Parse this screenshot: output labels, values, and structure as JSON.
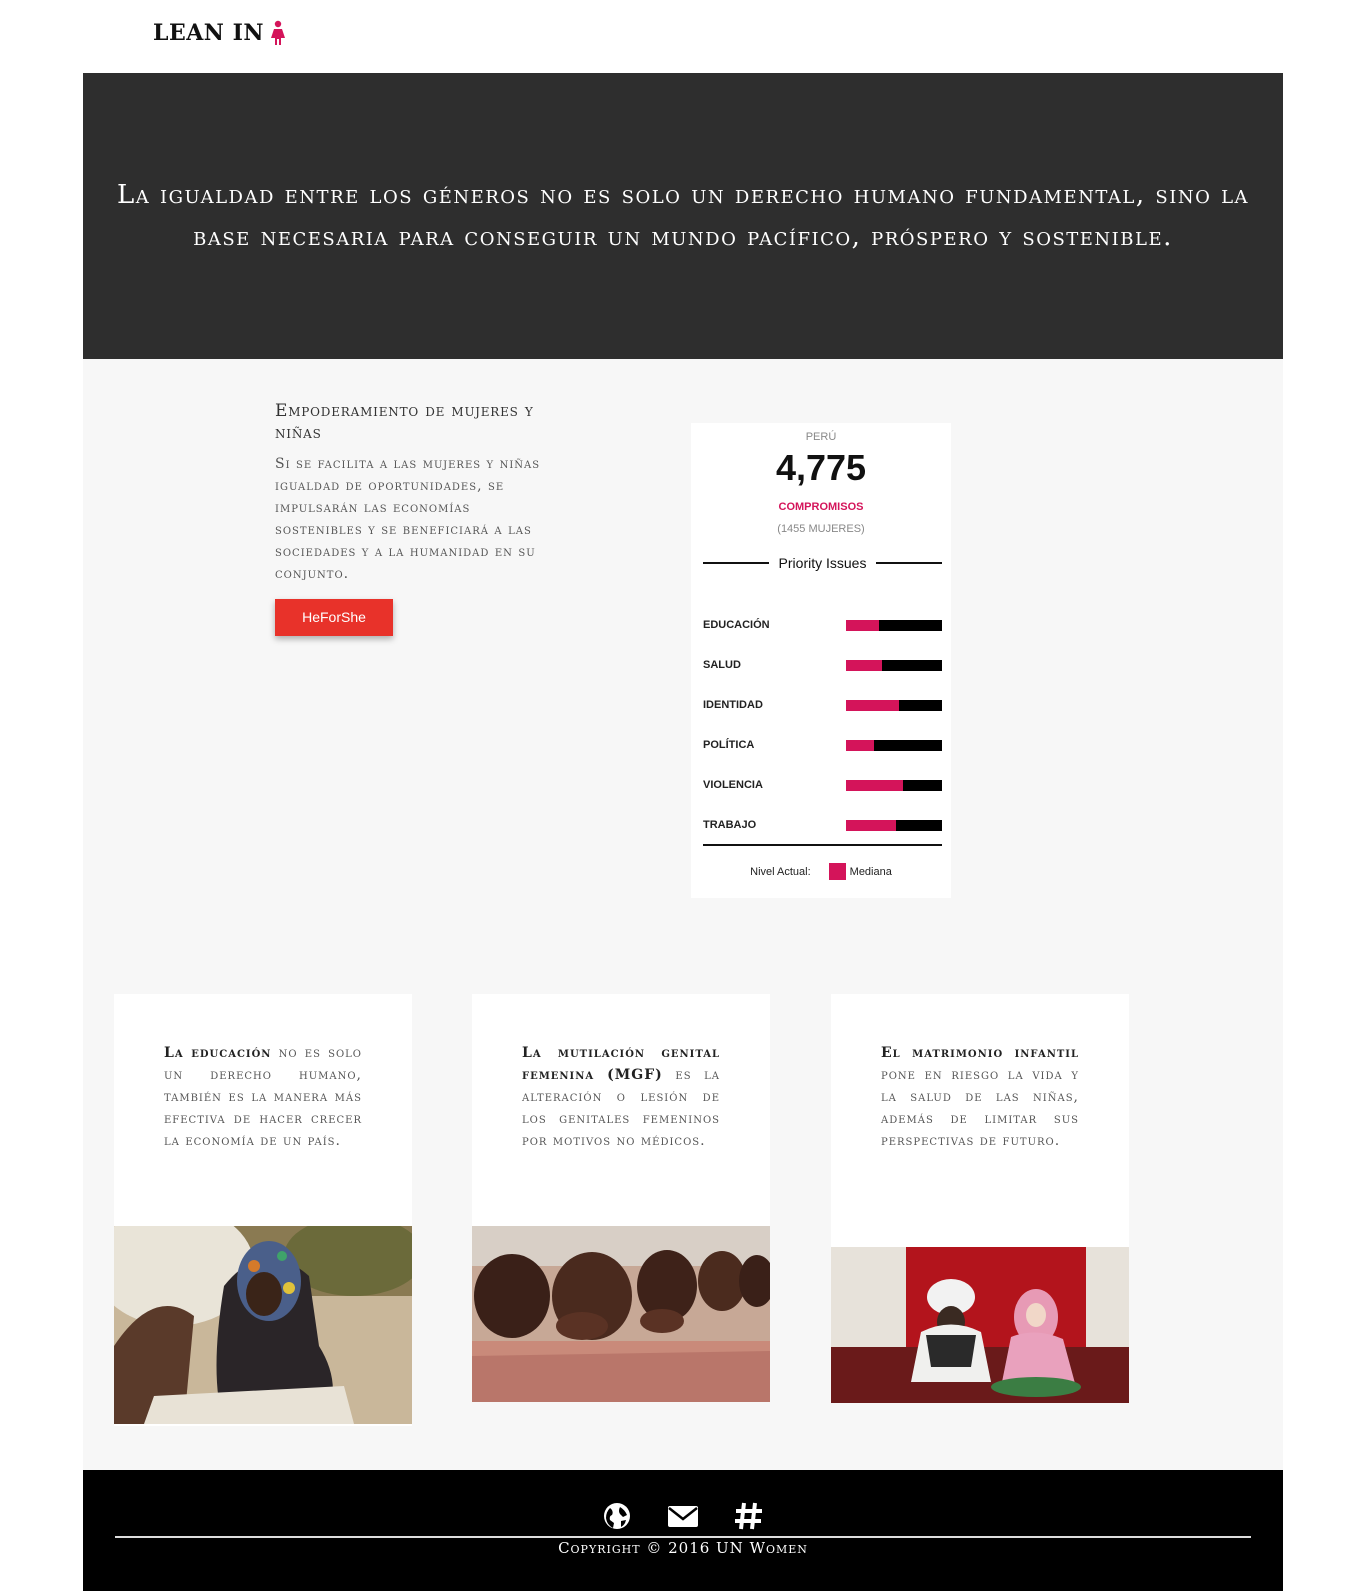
{
  "header": {
    "logo_text": "LEAN IN",
    "logo_icon": "woman-icon",
    "accent": "#d4145a"
  },
  "hero": {
    "quote": "La igualdad entre los géneros no es solo un derecho humano fundamental, sino la base necesaria para conseguir un mundo pacífico, próspero y sostenible."
  },
  "intro": {
    "title": "Empoderamiento de mujeres y niñas",
    "text": "Si se facilita a las mujeres y niñas igualdad de oportunidades, se impulsarán las economías sostenibles y se beneficiará a las sociedades y a la humanidad en su conjunto.",
    "button_label": "HeForShe",
    "button_color": "#e8322a"
  },
  "widget": {
    "country": "PERÚ",
    "count": "4,775",
    "label": "COMPROMISOS",
    "sub": "(1455 MUJERES)",
    "priority_title": "Priority Issues",
    "issues": [
      {
        "name": "EDUCACIÓN",
        "level": 0.34
      },
      {
        "name": "SALUD",
        "level": 0.38
      },
      {
        "name": "IDENTIDAD",
        "level": 0.55
      },
      {
        "name": "POLÍTICA",
        "level": 0.29
      },
      {
        "name": "VIOLENCIA",
        "level": 0.59
      },
      {
        "name": "TRABAJO",
        "level": 0.52
      }
    ],
    "legend_label": "Nivel Actual:",
    "legend_value": "Mediana",
    "bar_color": "#d4145a"
  },
  "cards": [
    {
      "bold": "La educación",
      "text": " no es solo un derecho humano, también es la manera más efectiva de hacer crecer la economía de un país.",
      "image": "student-writing-photo"
    },
    {
      "bold": "La mutilación genital femenina (MGF)",
      "text": " es la alteración o lesión de los genitales femeninos por motivos no médicos.",
      "image": "girls-covering-faces-photo"
    },
    {
      "bold": "El matrimonio infantil",
      "text": " pone en riesgo la vida y la salud de las niñas, además de limitar sus perspectivas de futuro.",
      "image": "man-and-girl-photo"
    }
  ],
  "footer": {
    "icons": [
      "globe-icon",
      "envelope-icon",
      "hashtag-icon"
    ],
    "copyright": "Copyright © 2016 UN Women"
  }
}
